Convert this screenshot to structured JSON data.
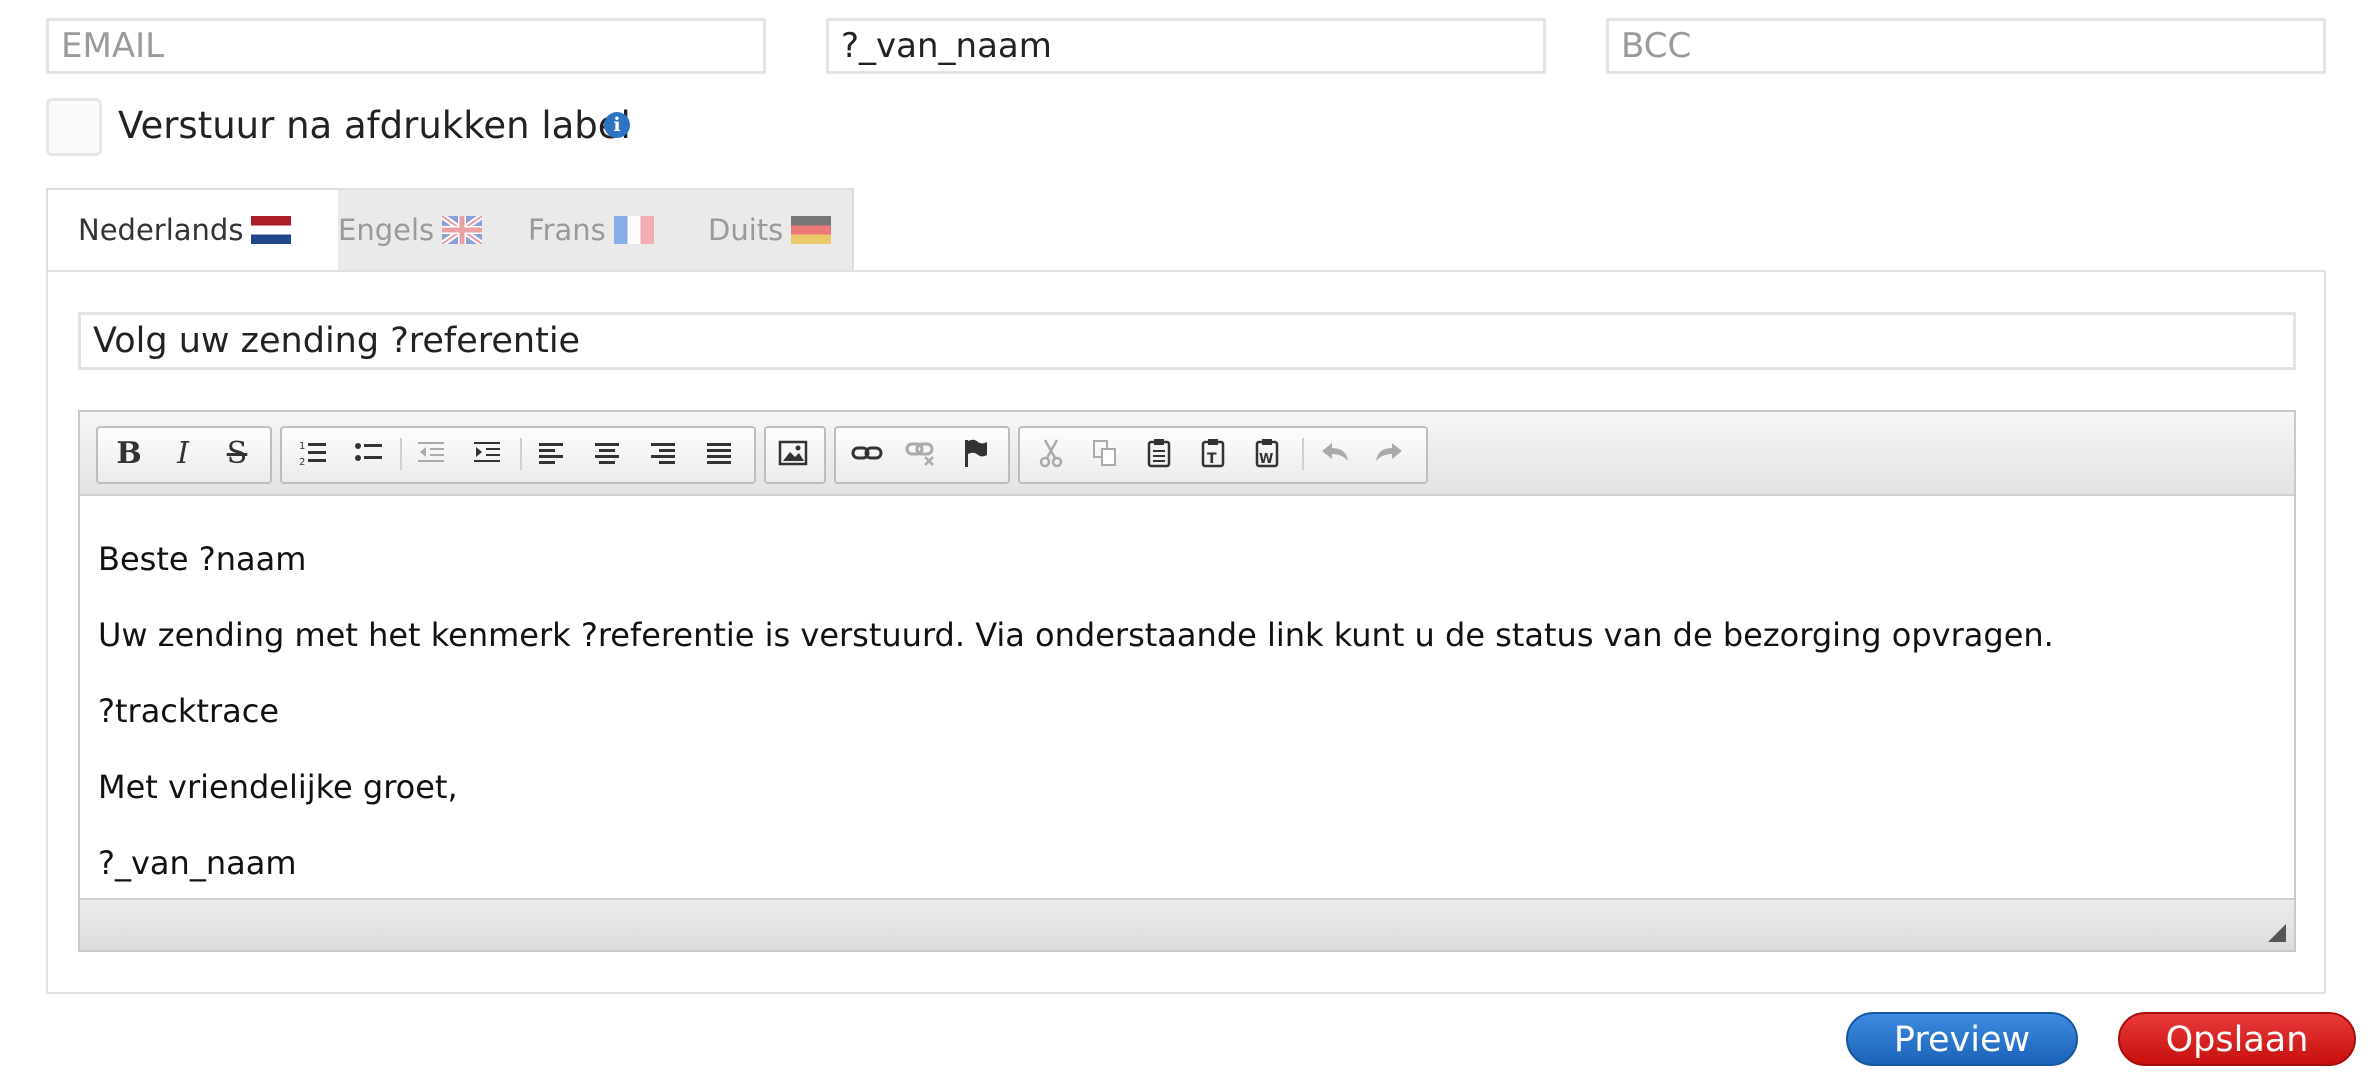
{
  "fields": {
    "email_placeholder": "EMAIL",
    "from_name_value": "?_van_naam",
    "bcc_placeholder": "BCC"
  },
  "send_option": {
    "label": "Verstuur na afdrukken label",
    "checked": false,
    "info_icon": "info-icon"
  },
  "tabs": [
    {
      "label": "Nederlands",
      "flag": "flag-nl",
      "active": true
    },
    {
      "label": "Engels",
      "flag": "flag-uk",
      "active": false
    },
    {
      "label": "Frans",
      "flag": "flag-fr",
      "active": false
    },
    {
      "label": "Duits",
      "flag": "flag-de",
      "active": false
    }
  ],
  "subject": {
    "value": "Volg uw zending ?referentie"
  },
  "editor": {
    "toolbar": [
      "bold-icon",
      "italic-icon",
      "strikethrough-icon",
      "numbered-list-icon",
      "bulleted-list-icon",
      "outdent-icon",
      "indent-icon",
      "align-left-icon",
      "align-center-icon",
      "align-right-icon",
      "justify-icon",
      "image-icon",
      "link-icon",
      "unlink-icon",
      "anchor-flag-icon",
      "cut-icon",
      "copy-icon",
      "paste-icon",
      "paste-text-icon",
      "paste-word-icon",
      "undo-icon",
      "redo-icon"
    ],
    "body": [
      "Beste ?naam",
      "Uw zending met het kenmerk ?referentie is verstuurd. Via onderstaande link kunt u de status van de bezorging opvragen.",
      "?tracktrace",
      "Met vriendelijke groet,",
      "?_van_naam"
    ]
  },
  "buttons": {
    "preview": "Preview",
    "save": "Opslaan"
  },
  "colors": {
    "preview_button": "#1f6fc5",
    "save_button": "#d81b1b",
    "info_icon": "#2f74c0"
  }
}
